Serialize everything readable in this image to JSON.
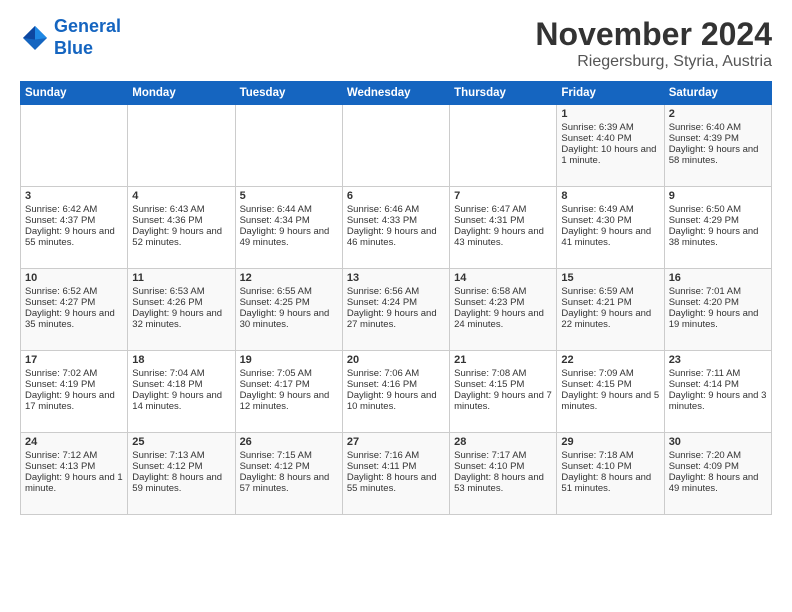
{
  "logo": {
    "line1": "General",
    "line2": "Blue"
  },
  "title": "November 2024",
  "location": "Riegersburg, Styria, Austria",
  "days_of_week": [
    "Sunday",
    "Monday",
    "Tuesday",
    "Wednesday",
    "Thursday",
    "Friday",
    "Saturday"
  ],
  "weeks": [
    [
      {
        "day": "",
        "content": ""
      },
      {
        "day": "",
        "content": ""
      },
      {
        "day": "",
        "content": ""
      },
      {
        "day": "",
        "content": ""
      },
      {
        "day": "",
        "content": ""
      },
      {
        "day": "1",
        "content": "Sunrise: 6:39 AM\nSunset: 4:40 PM\nDaylight: 10 hours and 1 minute."
      },
      {
        "day": "2",
        "content": "Sunrise: 6:40 AM\nSunset: 4:39 PM\nDaylight: 9 hours and 58 minutes."
      }
    ],
    [
      {
        "day": "3",
        "content": "Sunrise: 6:42 AM\nSunset: 4:37 PM\nDaylight: 9 hours and 55 minutes."
      },
      {
        "day": "4",
        "content": "Sunrise: 6:43 AM\nSunset: 4:36 PM\nDaylight: 9 hours and 52 minutes."
      },
      {
        "day": "5",
        "content": "Sunrise: 6:44 AM\nSunset: 4:34 PM\nDaylight: 9 hours and 49 minutes."
      },
      {
        "day": "6",
        "content": "Sunrise: 6:46 AM\nSunset: 4:33 PM\nDaylight: 9 hours and 46 minutes."
      },
      {
        "day": "7",
        "content": "Sunrise: 6:47 AM\nSunset: 4:31 PM\nDaylight: 9 hours and 43 minutes."
      },
      {
        "day": "8",
        "content": "Sunrise: 6:49 AM\nSunset: 4:30 PM\nDaylight: 9 hours and 41 minutes."
      },
      {
        "day": "9",
        "content": "Sunrise: 6:50 AM\nSunset: 4:29 PM\nDaylight: 9 hours and 38 minutes."
      }
    ],
    [
      {
        "day": "10",
        "content": "Sunrise: 6:52 AM\nSunset: 4:27 PM\nDaylight: 9 hours and 35 minutes."
      },
      {
        "day": "11",
        "content": "Sunrise: 6:53 AM\nSunset: 4:26 PM\nDaylight: 9 hours and 32 minutes."
      },
      {
        "day": "12",
        "content": "Sunrise: 6:55 AM\nSunset: 4:25 PM\nDaylight: 9 hours and 30 minutes."
      },
      {
        "day": "13",
        "content": "Sunrise: 6:56 AM\nSunset: 4:24 PM\nDaylight: 9 hours and 27 minutes."
      },
      {
        "day": "14",
        "content": "Sunrise: 6:58 AM\nSunset: 4:23 PM\nDaylight: 9 hours and 24 minutes."
      },
      {
        "day": "15",
        "content": "Sunrise: 6:59 AM\nSunset: 4:21 PM\nDaylight: 9 hours and 22 minutes."
      },
      {
        "day": "16",
        "content": "Sunrise: 7:01 AM\nSunset: 4:20 PM\nDaylight: 9 hours and 19 minutes."
      }
    ],
    [
      {
        "day": "17",
        "content": "Sunrise: 7:02 AM\nSunset: 4:19 PM\nDaylight: 9 hours and 17 minutes."
      },
      {
        "day": "18",
        "content": "Sunrise: 7:04 AM\nSunset: 4:18 PM\nDaylight: 9 hours and 14 minutes."
      },
      {
        "day": "19",
        "content": "Sunrise: 7:05 AM\nSunset: 4:17 PM\nDaylight: 9 hours and 12 minutes."
      },
      {
        "day": "20",
        "content": "Sunrise: 7:06 AM\nSunset: 4:16 PM\nDaylight: 9 hours and 10 minutes."
      },
      {
        "day": "21",
        "content": "Sunrise: 7:08 AM\nSunset: 4:15 PM\nDaylight: 9 hours and 7 minutes."
      },
      {
        "day": "22",
        "content": "Sunrise: 7:09 AM\nSunset: 4:15 PM\nDaylight: 9 hours and 5 minutes."
      },
      {
        "day": "23",
        "content": "Sunrise: 7:11 AM\nSunset: 4:14 PM\nDaylight: 9 hours and 3 minutes."
      }
    ],
    [
      {
        "day": "24",
        "content": "Sunrise: 7:12 AM\nSunset: 4:13 PM\nDaylight: 9 hours and 1 minute."
      },
      {
        "day": "25",
        "content": "Sunrise: 7:13 AM\nSunset: 4:12 PM\nDaylight: 8 hours and 59 minutes."
      },
      {
        "day": "26",
        "content": "Sunrise: 7:15 AM\nSunset: 4:12 PM\nDaylight: 8 hours and 57 minutes."
      },
      {
        "day": "27",
        "content": "Sunrise: 7:16 AM\nSunset: 4:11 PM\nDaylight: 8 hours and 55 minutes."
      },
      {
        "day": "28",
        "content": "Sunrise: 7:17 AM\nSunset: 4:10 PM\nDaylight: 8 hours and 53 minutes."
      },
      {
        "day": "29",
        "content": "Sunrise: 7:18 AM\nSunset: 4:10 PM\nDaylight: 8 hours and 51 minutes."
      },
      {
        "day": "30",
        "content": "Sunrise: 7:20 AM\nSunset: 4:09 PM\nDaylight: 8 hours and 49 minutes."
      }
    ]
  ]
}
